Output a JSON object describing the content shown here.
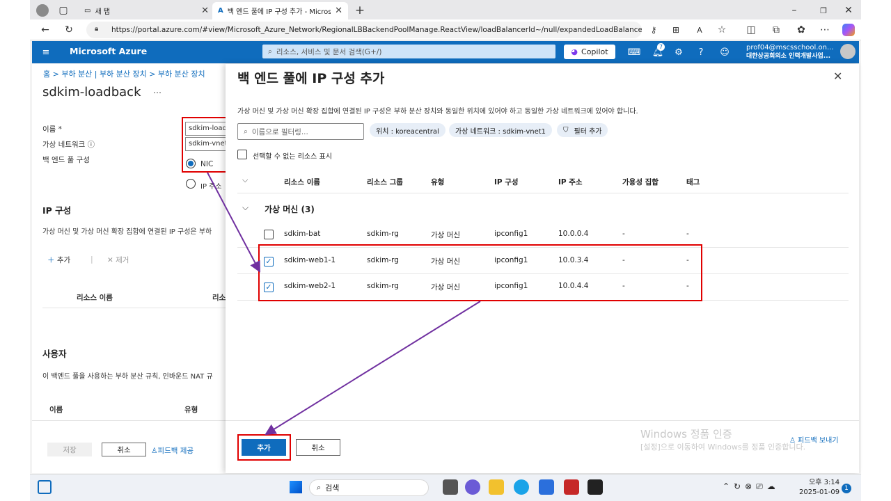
{
  "browser": {
    "tabs": [
      {
        "label": "새 탭"
      },
      {
        "label": "백 엔드 풀에 IP 구성 추가 - Microsof"
      }
    ],
    "url": "https://portal.azure.com/#view/Microsoft_Azure_Network/RegionalLBBackendPoolManage.ReactView/loadBalancerId~/null/expandedLoadBalancer~/..."
  },
  "azure": {
    "brand": "Microsoft Azure",
    "search_placeholder": "리소스, 서비스 및 문서 검색(G+/)",
    "copilot": "Copilot",
    "notification_count": "7",
    "user_email": "prof04@mscsschool.on...",
    "user_org": "대한상공회의소 인력개발사업..."
  },
  "left": {
    "breadcrumb": "홈 > 부하 분산 | 부하 분산 장치 > 부하 분산 장치",
    "title": "sdkim-loadback",
    "name_label": "이름 *",
    "name_value": "sdkim-loadl",
    "vnet_label": "가상 네트워크 ⓘ",
    "vnet_value": "sdkim-vnet",
    "pool_config_label": "백 엔드 풀 구성",
    "nic_label": "NIC",
    "ip_label": "IP 주소",
    "ip_section": "IP 구성",
    "ip_desc": "가상 머신 및 가상 머신 확장 집합에 연결된 IP 구성은 부하",
    "add": "추가",
    "remove": "제거",
    "col_resource": "리소스 이름",
    "col_resource2": "리소",
    "users_section": "사용자",
    "users_desc": "이 백엔드 풀을 사용하는 부하 분산 규칙, 인바운드 NAT 규",
    "col_name": "이름",
    "col_type": "유형",
    "save": "저장",
    "cancel": "취소",
    "feedback": "피드백 제공"
  },
  "panel": {
    "title": "백 엔드 풀에 IP 구성 추가",
    "description": "가상 머신 및 가상 머신 확장 집합에 연결된 IP 구성은 부하 분산 장치와 동일한 위치에 있어야 하고 동일한 가상 네트워크에 있어야 합니다.",
    "filter_placeholder": "이름으로 필터링...",
    "pill_location": "위치 : koreacentral",
    "pill_vnet": "가상 네트워크 : sdkim-vnet1",
    "pill_filter": "필터 추가",
    "show_unselectable": "선택할 수 없는 리소스 표시",
    "headers": [
      "리소스 이름",
      "리소스 그룹",
      "유형",
      "IP 구성",
      "IP 주소",
      "가용성 집합",
      "태그"
    ],
    "group_label": "가상 머신 (3)",
    "rows": [
      {
        "name": "sdkim-bat",
        "rg": "sdkim-rg",
        "type": "가상 머신",
        "ipconfig": "ipconfig1",
        "ip": "10.0.0.4",
        "avset": "-",
        "tags": "-",
        "checked": false
      },
      {
        "name": "sdkim-web1-1",
        "rg": "sdkim-rg",
        "type": "가상 머신",
        "ipconfig": "ipconfig1",
        "ip": "10.0.3.4",
        "avset": "-",
        "tags": "-",
        "checked": true
      },
      {
        "name": "sdkim-web2-1",
        "rg": "sdkim-rg",
        "type": "가상 머신",
        "ipconfig": "ipconfig1",
        "ip": "10.0.4.4",
        "avset": "-",
        "tags": "-",
        "checked": true
      }
    ],
    "add_button": "추가",
    "cancel_button": "취소",
    "feedback": "피드백 보내기"
  },
  "watermark": {
    "line1": "Windows 정품 인증",
    "line2": "[설정]으로 이동하여 Windows를 정품 인증합니다."
  },
  "taskbar": {
    "search": "검색",
    "time": "오후 3:14",
    "date": "2025-01-09",
    "notif": "1"
  },
  "colors": {
    "azure_blue": "#0f6cbd",
    "annotation_red": "#e00000",
    "arrow_purple": "#7030a0"
  }
}
